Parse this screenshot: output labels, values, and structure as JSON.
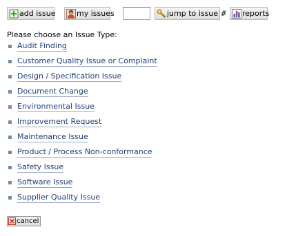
{
  "toolbar": {
    "add_issue_label": "add issue",
    "add_issue_icon": "add-plus-icon",
    "my_issues_label": "my issues",
    "my_issues_icon": "user-icon",
    "jump_input_value": "",
    "jump_label": "jump to issue #",
    "jump_icon": "key-icon",
    "reports_label": "reports",
    "reports_icon": "bar-chart-icon"
  },
  "prompt": "Please choose an Issue Type:",
  "issue_types": [
    "Audit Finding",
    "Customer Quality Issue or Complaint",
    "Design / Specification Issue",
    "Document Change",
    "Environmental Issue",
    "Improvement Request",
    "Maintenance Issue",
    "Product / Process Non-conformance",
    "Safety Issue",
    "Software Issue",
    "Supplier Quality Issue"
  ],
  "cancel": {
    "label": "cancel",
    "icon": "cancel-x-icon"
  },
  "colors": {
    "link": "#1f3f75",
    "bullet": "#6f8db0",
    "add_icon_green": "#3aa528",
    "cancel_icon_red": "#d23a2a"
  }
}
